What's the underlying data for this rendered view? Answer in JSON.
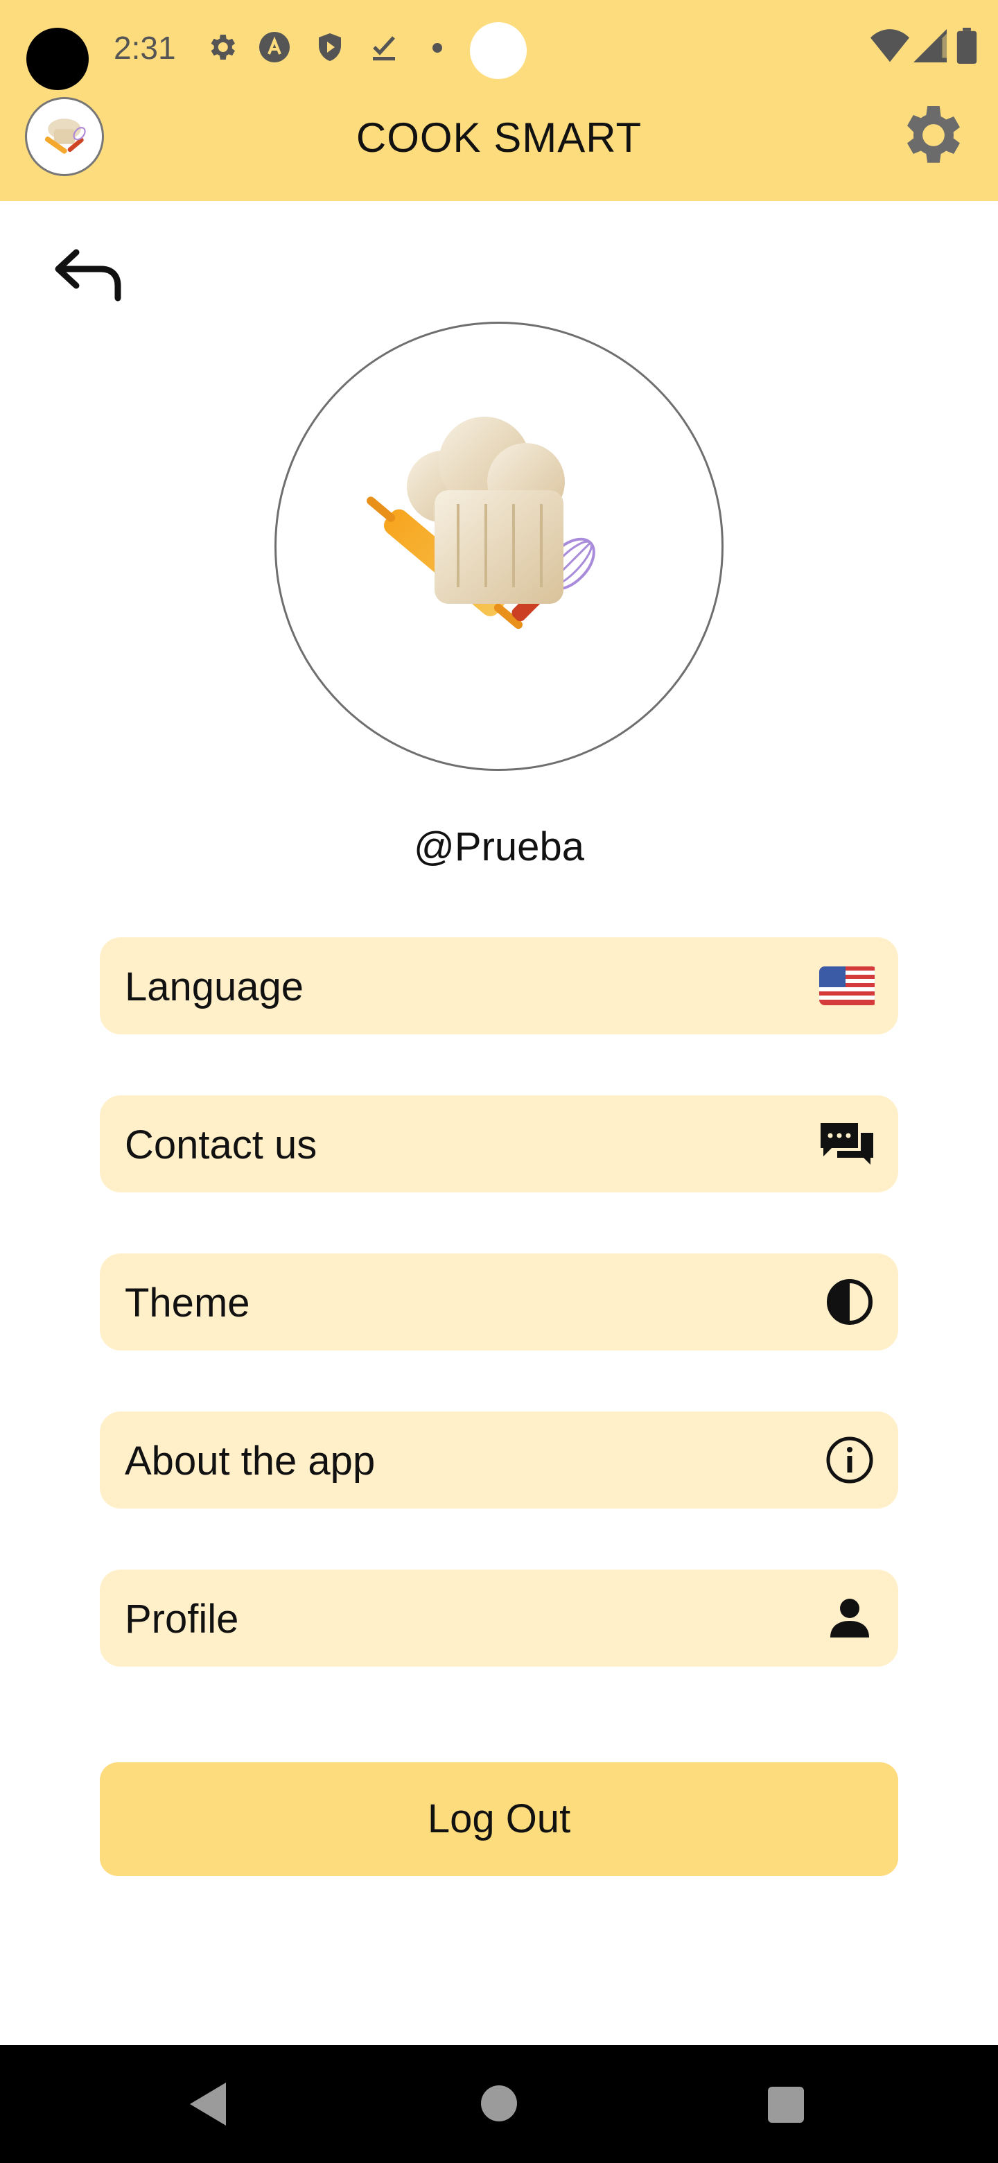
{
  "status_bar": {
    "time": "2:31",
    "icons": [
      "settings-icon",
      "a-icon",
      "shield-play-icon",
      "check-download-icon",
      "dot-icon",
      "wifi-icon",
      "signal-icon",
      "battery-icon"
    ]
  },
  "app_bar": {
    "title": "COOK SMART",
    "logo": "chef-hat-logo",
    "settings_icon": "gear-icon"
  },
  "profile": {
    "username": "@Prueba",
    "avatar": "chef-hat-avatar"
  },
  "menu": [
    {
      "label": "Language",
      "icon": "us-flag-icon"
    },
    {
      "label": "Contact us",
      "icon": "chat-bubbles-icon"
    },
    {
      "label": "Theme",
      "icon": "contrast-icon"
    },
    {
      "label": "About the app",
      "icon": "info-icon"
    },
    {
      "label": "Profile",
      "icon": "person-icon"
    }
  ],
  "logout": {
    "label": "Log Out"
  },
  "nav_bar": {
    "buttons": [
      "back",
      "home",
      "recents"
    ]
  },
  "colors": {
    "primary": "#fddc7d",
    "menu_bg": "#fff0c9",
    "text": "#111111"
  }
}
